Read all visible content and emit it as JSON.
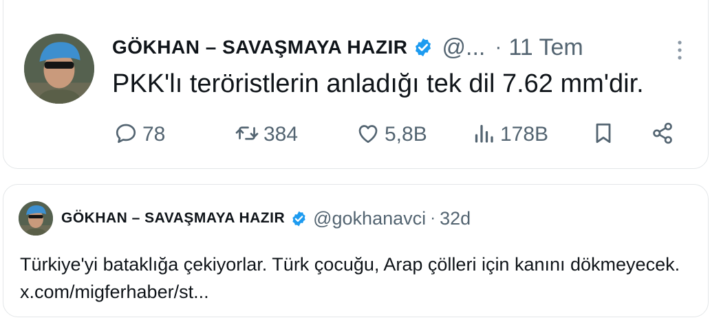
{
  "tweet": {
    "author_name": "GÖKHAN – SAVAŞMAYA HAZIR",
    "handle": "@...",
    "separator": "·",
    "time": "11 Tem",
    "text": "PKK'lı teröristlerin anladığı tek dil 7.62 mm'dir.",
    "actions": {
      "replies": "78",
      "reposts": "384",
      "likes": "5,8B",
      "views": "178B"
    }
  },
  "quoted_tweet": {
    "author_name": "GÖKHAN – SAVAŞMAYA HAZIR",
    "handle": "@gokhanavci",
    "separator": "·",
    "time": "32d",
    "text": "Türkiye'yi bataklığa çekiyorlar. Türk çocuğu, Arap çölleri için kanını dökmeyecek. x.com/migferhaber/st..."
  },
  "icons": {
    "verified": "verified-badge-icon",
    "more": "more-vertical-icon",
    "reply": "reply-icon",
    "repost": "repost-icon",
    "like": "heart-icon",
    "views": "views-icon",
    "bookmark": "bookmark-icon",
    "share": "share-icon"
  },
  "colors": {
    "text": "#0f1419",
    "muted": "#536471",
    "verified": "#1d9bf0",
    "border": "#e3e6e8"
  }
}
